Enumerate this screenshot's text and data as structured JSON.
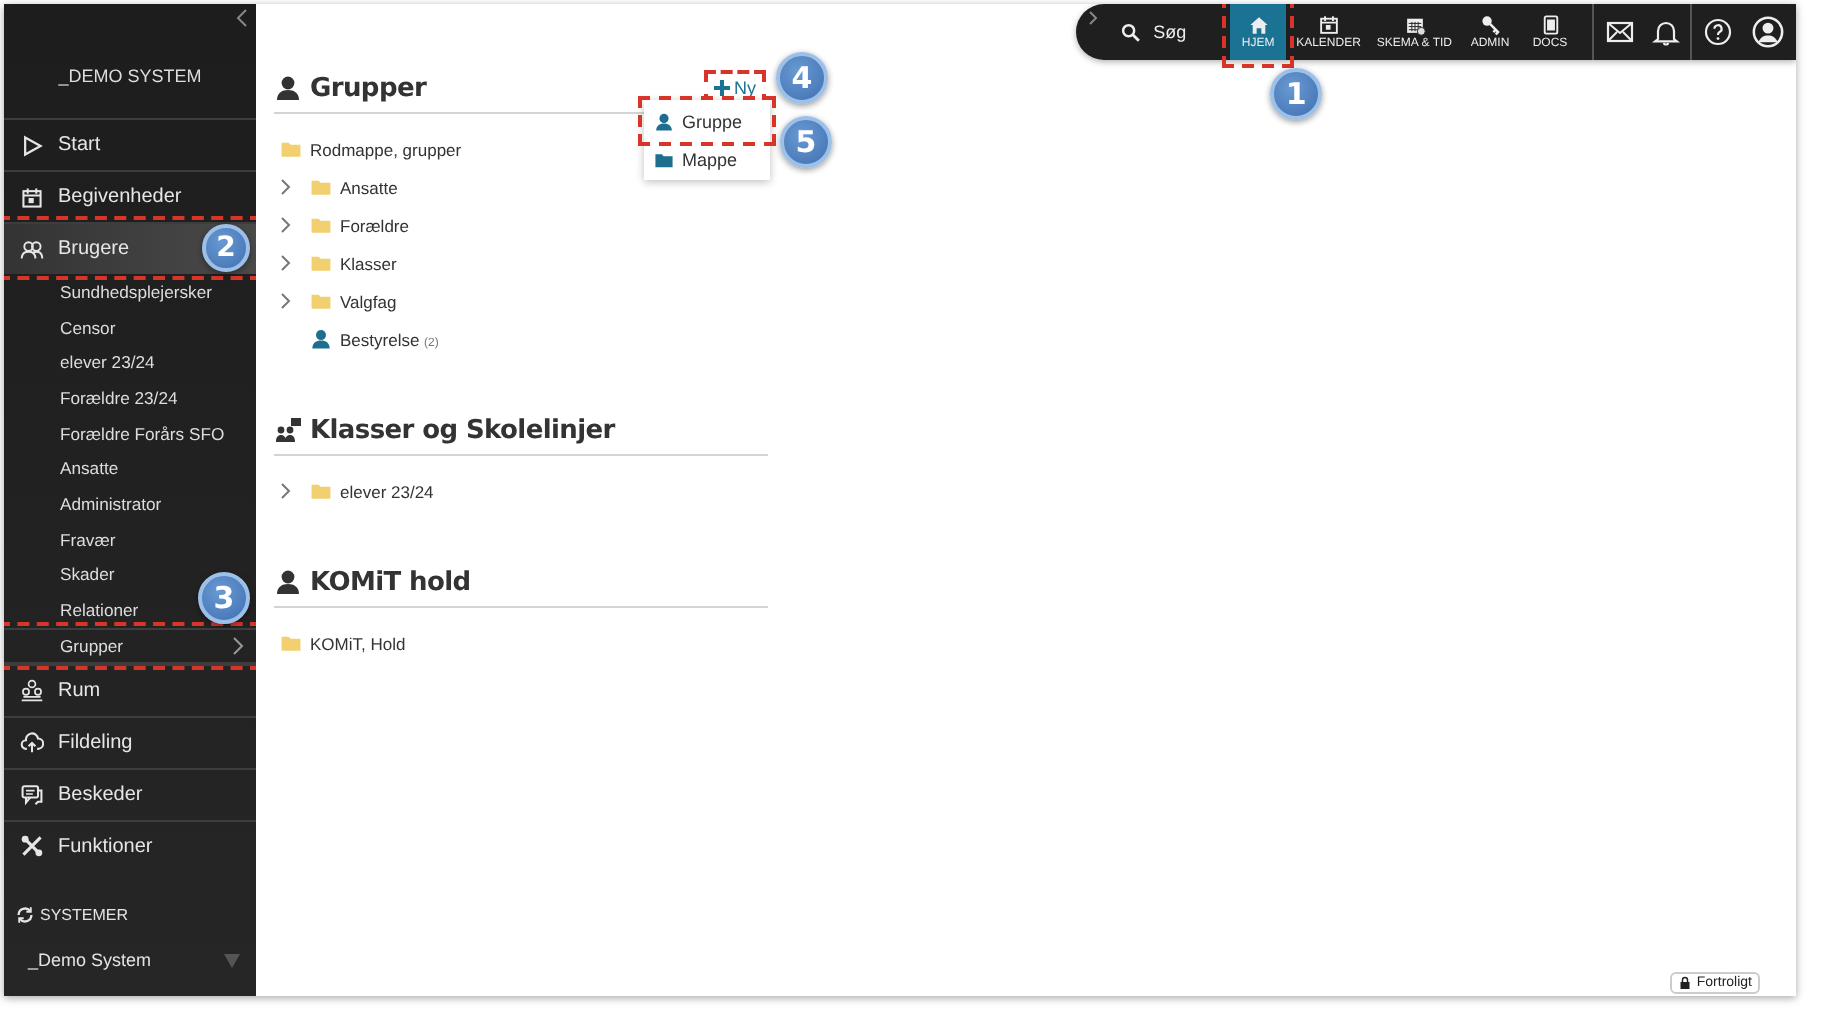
{
  "sidebar": {
    "title": "_DEMO SYSTEM",
    "items": [
      {
        "label": "Start",
        "selected": false
      },
      {
        "label": "Begivenheder",
        "selected": false
      },
      {
        "label": "Brugere",
        "selected": true,
        "highlighted": true,
        "callout": "2",
        "children": [
          {
            "label": "Sundhedsplejersker"
          },
          {
            "label": "Censor"
          },
          {
            "label": "elever 23/24"
          },
          {
            "label": "Forældre 23/24"
          },
          {
            "label": "Forældre Forårs SFO"
          },
          {
            "label": "Ansatte"
          },
          {
            "label": "Administrator"
          },
          {
            "label": "Fravær"
          },
          {
            "label": "Skader"
          },
          {
            "label": "Relationer"
          },
          {
            "label": "Grupper",
            "has_submenu": true,
            "highlighted": true,
            "callout": "3"
          }
        ]
      },
      {
        "label": "Rum",
        "selected": false
      },
      {
        "label": "Fildeling",
        "selected": false
      },
      {
        "label": "Beskeder",
        "selected": false
      },
      {
        "label": "Funktioner",
        "selected": false
      }
    ],
    "systems": {
      "label": "SYSTEMER",
      "current": "_Demo System"
    }
  },
  "topbar": {
    "search": "Søg",
    "apps": [
      {
        "label": "HJEM",
        "selected": true,
        "highlighted": true,
        "callout": "1"
      },
      {
        "label": "KALENDER",
        "selected": false
      },
      {
        "label": "SKEMA & TID",
        "selected": false
      },
      {
        "label": "ADMIN",
        "selected": false
      },
      {
        "label": "DOCS",
        "selected": false
      }
    ]
  },
  "sections": [
    {
      "title": "Grupper",
      "new_button": {
        "label": "Ny",
        "highlighted": true,
        "callout": "4"
      },
      "menu": [
        {
          "label": "Gruppe",
          "highlighted": true,
          "callout": "5"
        },
        {
          "label": "Mappe"
        }
      ],
      "items": [
        {
          "label": "Rodmappe, grupper",
          "kind": "folder",
          "expandable": false,
          "children": [
            {
              "label": "Ansatte",
              "kind": "folder",
              "expandable": true
            },
            {
              "label": "Forældre",
              "kind": "folder",
              "expandable": true
            },
            {
              "label": "Klasser",
              "kind": "folder",
              "expandable": true
            },
            {
              "label": "Valgfag",
              "kind": "folder",
              "expandable": true
            },
            {
              "label": "Bestyrelse",
              "kind": "group",
              "expandable": false,
              "count": "(2)"
            }
          ]
        }
      ]
    },
    {
      "title": "Klasser og Skolelinjer",
      "items": [
        {
          "label": "elever 23/24",
          "kind": "folder",
          "expandable": true
        }
      ]
    },
    {
      "title": "KOMiT hold",
      "items": [
        {
          "label": "KOMiT, Hold",
          "kind": "folder",
          "expandable": false
        }
      ]
    }
  ],
  "confidential": "Fortroligt"
}
